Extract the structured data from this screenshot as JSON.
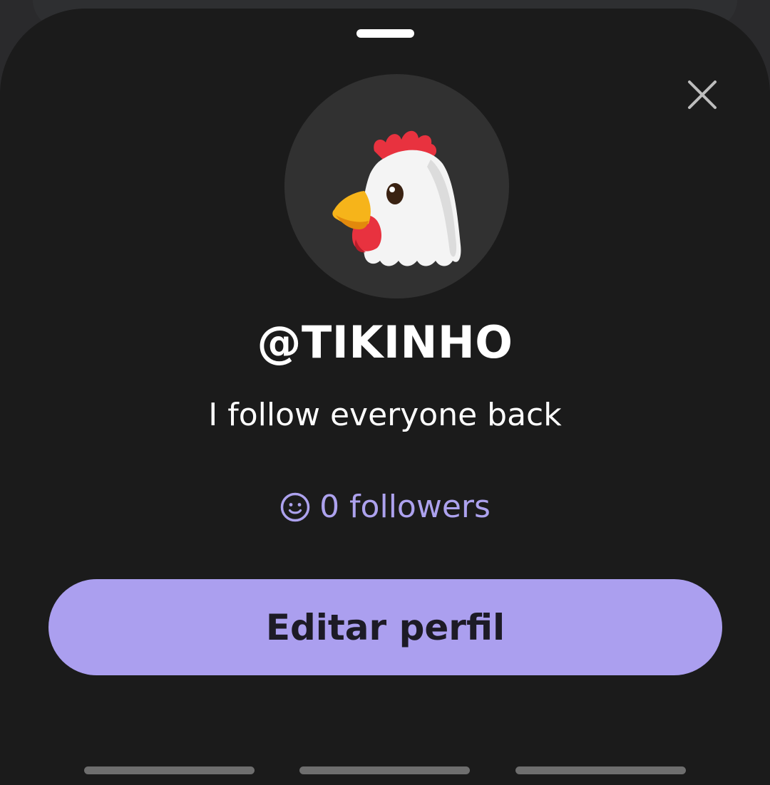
{
  "profile": {
    "username": "@TIKINHO",
    "bio": "I follow everyone back",
    "followers_label": "0 followers",
    "edit_button_label": "Editar perfil",
    "avatar_icon": "rooster-icon"
  },
  "icons": {
    "close": "close-icon",
    "followers": "smiley-icon"
  },
  "colors": {
    "sheet_background": "#1b1b1b",
    "avatar_background": "#313131",
    "accent": "#ab9fef",
    "followers_text": "#ada2ee",
    "button_text": "#1d1b26",
    "text": "#ffffff"
  },
  "bottom_tabs": [
    "tab-indicator-1",
    "tab-indicator-2",
    "tab-indicator-3"
  ]
}
